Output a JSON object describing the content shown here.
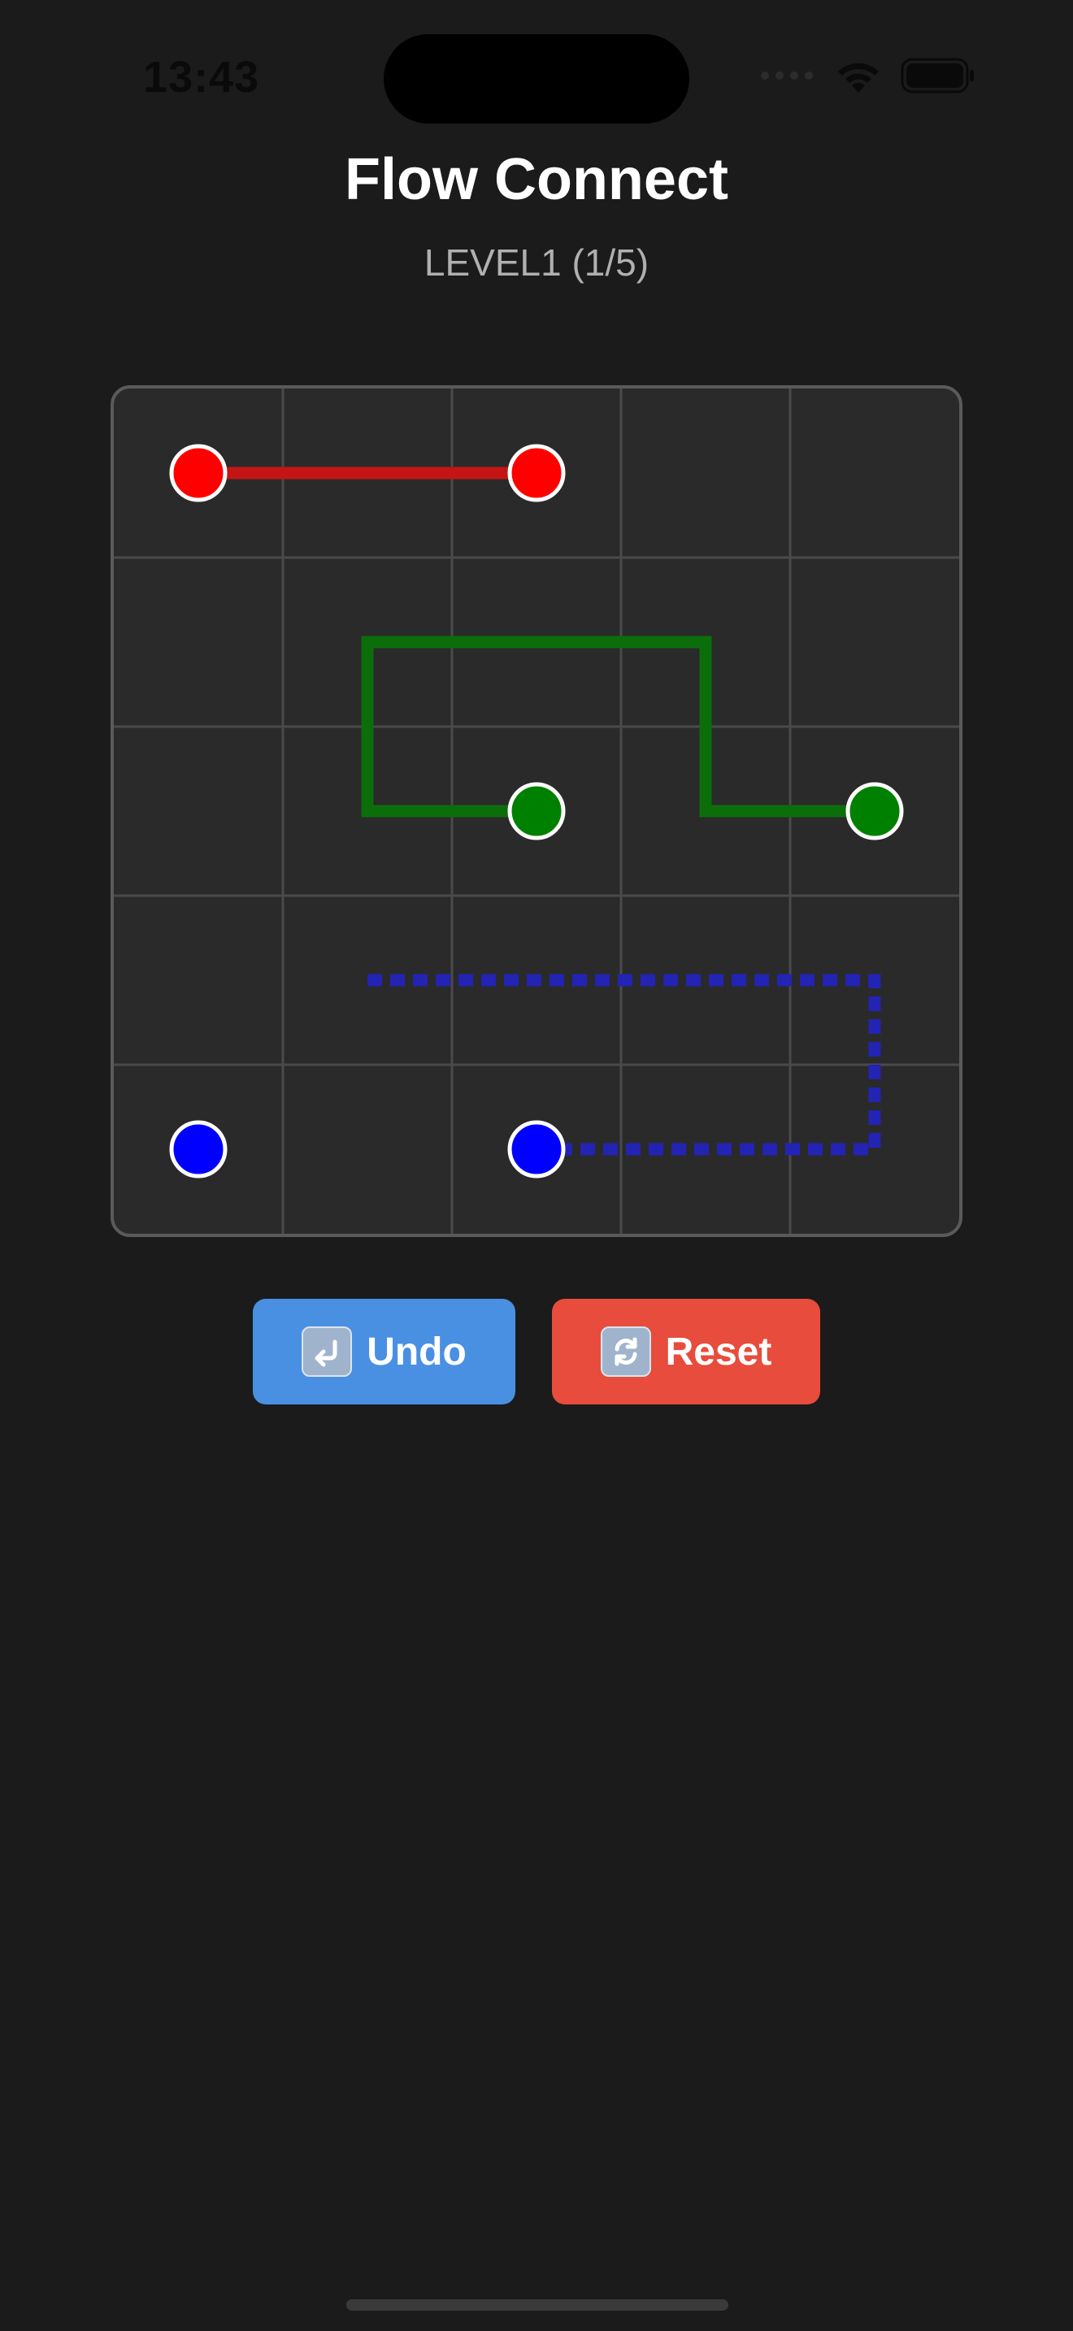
{
  "status_bar": {
    "time": "13:43",
    "icons": [
      "signal-dots-icon",
      "wifi-icon",
      "battery-icon"
    ]
  },
  "header": {
    "title": "Flow Connect",
    "level": "LEVEL1 (1/5)"
  },
  "board": {
    "rows": 5,
    "cols": 5,
    "colors": {
      "background": "#2a2a2a",
      "grid": "#4a4a4a",
      "border": "#5a5a5a"
    },
    "dots": [
      {
        "color": "red",
        "fill": "#ff0000",
        "row": 0,
        "col": 0
      },
      {
        "color": "red",
        "fill": "#ff0000",
        "row": 0,
        "col": 2
      },
      {
        "color": "green",
        "fill": "#008000",
        "row": 2,
        "col": 2
      },
      {
        "color": "green",
        "fill": "#008000",
        "row": 2,
        "col": 4
      },
      {
        "color": "blue",
        "fill": "#0000ff",
        "row": 4,
        "col": 0
      },
      {
        "color": "blue",
        "fill": "#0000ff",
        "row": 4,
        "col": 2
      }
    ],
    "paths": [
      {
        "color": "red",
        "stroke": "#c41414",
        "dashed": false,
        "cells": [
          [
            0,
            0
          ],
          [
            0,
            1
          ],
          [
            0,
            2
          ]
        ]
      },
      {
        "color": "green",
        "stroke": "#0b6e0b",
        "dashed": false,
        "cells": [
          [
            2,
            2
          ],
          [
            2,
            1
          ],
          [
            1,
            1
          ],
          [
            1,
            2
          ],
          [
            1,
            3
          ],
          [
            2,
            3
          ],
          [
            2,
            4
          ]
        ]
      },
      {
        "color": "blue",
        "stroke": "#2323b4",
        "dashed": true,
        "cells": [
          [
            3,
            1
          ],
          [
            3,
            2
          ],
          [
            3,
            3
          ],
          [
            3,
            4
          ],
          [
            4,
            4
          ],
          [
            4,
            3
          ],
          [
            4,
            2
          ]
        ]
      }
    ]
  },
  "controls": {
    "undo": {
      "label": "Undo",
      "icon": "undo-arrow-icon",
      "color": "#4a90e2"
    },
    "reset": {
      "label": "Reset",
      "icon": "refresh-icon",
      "color": "#e74c3c"
    }
  }
}
